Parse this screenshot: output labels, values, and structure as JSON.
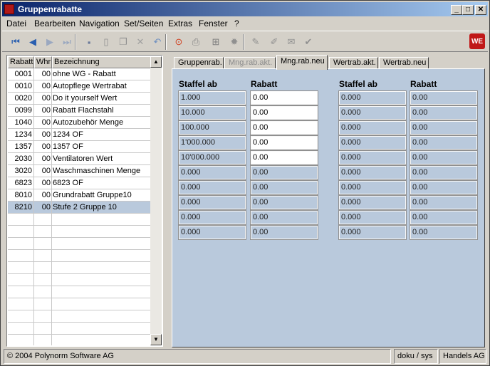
{
  "window": {
    "title": "Gruppenrabatte"
  },
  "title_buttons": {
    "minimize": "_",
    "maximize": "□",
    "close": "✕"
  },
  "menu": [
    {
      "label": "Datei",
      "u": "D"
    },
    {
      "label": "Bearbeiten",
      "u": "B"
    },
    {
      "label": "Navigation",
      "u": "N"
    },
    {
      "label": "Set/Seiten",
      "u": "S"
    },
    {
      "label": "Extras",
      "u": "E"
    },
    {
      "label": "Fenster",
      "u": "F"
    },
    {
      "label": "?",
      "u": "?"
    }
  ],
  "toolbar": {
    "icons": [
      "first-record-icon",
      "previous-record-icon",
      "next-record-icon",
      "last-record-icon",
      "save-icon",
      "new-document-icon",
      "copy-icon",
      "delete-icon",
      "undo-icon",
      "stop-icon",
      "print-icon",
      "tree-icon",
      "settings-icon",
      "edit-pen-icon",
      "edit-pen2-icon",
      "notepad-icon",
      "check-icon"
    ],
    "logo_text": "WE"
  },
  "list": {
    "columns": [
      "Rabatt",
      "Whr",
      "Bezeichnung"
    ],
    "rows": [
      {
        "code": "0001",
        "whr": "00",
        "desc": "ohne WG - Rabatt"
      },
      {
        "code": "0010",
        "whr": "00",
        "desc": "Autopflege Wertrabat"
      },
      {
        "code": "0020",
        "whr": "00",
        "desc": "Do it yourself Wert"
      },
      {
        "code": "0099",
        "whr": "00",
        "desc": "Rabatt Flachstahl"
      },
      {
        "code": "1040",
        "whr": "00",
        "desc": "Autozubehör Menge"
      },
      {
        "code": "1234",
        "whr": "00",
        "desc": "1234 OF"
      },
      {
        "code": "1357",
        "whr": "00",
        "desc": "1357 OF"
      },
      {
        "code": "2030",
        "whr": "00",
        "desc": "Ventilatoren Wert"
      },
      {
        "code": "3020",
        "whr": "00",
        "desc": "Waschmaschinen Menge"
      },
      {
        "code": "6823",
        "whr": "00",
        "desc": "6823 OF"
      },
      {
        "code": "8010",
        "whr": "00",
        "desc": "Grundrabatt Gruppe10"
      },
      {
        "code": "8210",
        "whr": "00",
        "desc": "Stufe 2 Gruppe 10",
        "selected": true
      }
    ],
    "empty_rows": 12
  },
  "tabs": [
    {
      "label": "Gruppenrab.",
      "state": "normal"
    },
    {
      "label": "Mng.rab.akt.",
      "state": "disabled"
    },
    {
      "label": "Mng.rab.neu",
      "state": "active"
    },
    {
      "label": "Wertrab.akt.",
      "state": "normal"
    },
    {
      "label": "Wertrab.neu",
      "state": "normal"
    }
  ],
  "grid": {
    "headers": [
      "Staffel ab",
      "Rabatt",
      "Staffel ab",
      "Rabatt"
    ],
    "left_staffel": [
      "1.000",
      "10.000",
      "100.000",
      "1'000.000",
      "10'000.000",
      "0.000",
      "0.000",
      "0.000",
      "0.000",
      "0.000"
    ],
    "left_rabatt": [
      "0.00",
      "0.00",
      "0.00",
      "0.00",
      "0.00",
      "0.00",
      "0.00",
      "0.00",
      "0.00",
      "0.00"
    ],
    "left_rabatt_editable": [
      true,
      true,
      true,
      true,
      true,
      false,
      false,
      false,
      false,
      false
    ],
    "right_staffel": [
      "0.000",
      "0.000",
      "0.000",
      "0.000",
      "0.000",
      "0.000",
      "0.000",
      "0.000",
      "0.000",
      "0.000"
    ],
    "right_rabatt": [
      "0.00",
      "0.00",
      "0.00",
      "0.00",
      "0.00",
      "0.00",
      "0.00",
      "0.00",
      "0.00",
      "0.00"
    ]
  },
  "status": {
    "copyright": "© 2004 Polynorm Software AG",
    "user": "doku / sys",
    "company": "Handels AG"
  }
}
